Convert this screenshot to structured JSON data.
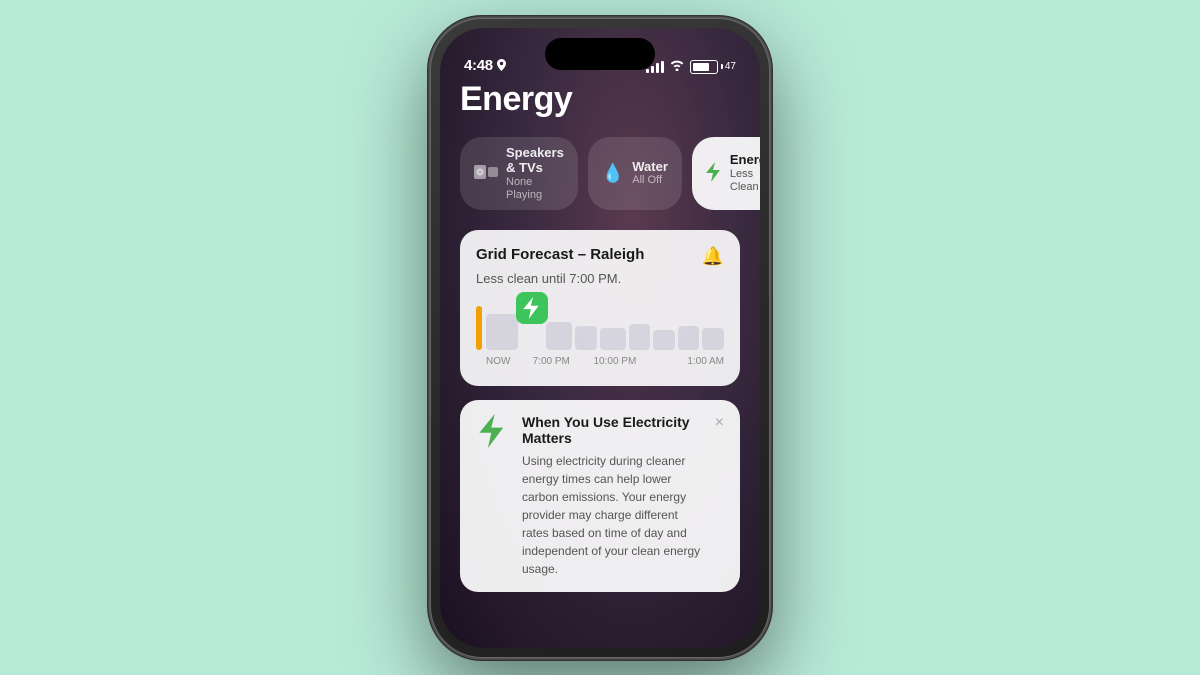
{
  "background_color": "#b8ead8",
  "status_bar": {
    "time": "4:48",
    "battery_percent": "47",
    "has_location": true
  },
  "page_title": "Energy",
  "pills": [
    {
      "id": "speakers",
      "icon_type": "speakers",
      "label": "Speakers & TVs",
      "sub": "None Playing",
      "active": false
    },
    {
      "id": "water",
      "icon_type": "water",
      "label": "Water",
      "sub": "All Off",
      "active": false
    },
    {
      "id": "energy",
      "icon_type": "lightning",
      "label": "Energy",
      "sub": "Less Clean",
      "active": true
    }
  ],
  "grid_forecast": {
    "title": "Grid Forecast – Raleigh",
    "subtitle": "Less clean until 7:00 PM.",
    "time_labels": [
      "NOW",
      "7:00 PM",
      "10:00 PM",
      "1:00 AM"
    ],
    "marker_time": "7:00 PM"
  },
  "info_card": {
    "title": "When You Use Electricity Matters",
    "body": "Using electricity during cleaner energy times can help lower carbon emissions. Your energy provider may charge different rates based on time of day and independent of your clean energy usage.",
    "close_label": "×"
  }
}
